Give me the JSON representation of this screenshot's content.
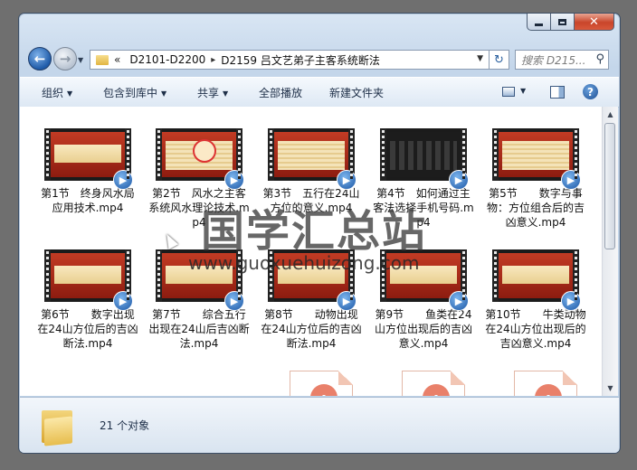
{
  "window": {
    "caption_min": "minimize",
    "caption_max": "maximize",
    "caption_close": "✕"
  },
  "address": {
    "prefix": "«",
    "crumbs": [
      "D2101-D2200",
      "D2159 吕文艺弟子主客系统断法"
    ],
    "separator": "▸"
  },
  "search": {
    "placeholder": "搜索 D215..."
  },
  "toolbar": {
    "organize": "组织",
    "include_library": "包含到库中",
    "share": "共享",
    "play_all": "全部播放",
    "new_folder": "新建文件夹",
    "help": "?"
  },
  "files": [
    {
      "label": "第1节　终身风水局应用技术.mp4",
      "style": "title"
    },
    {
      "label": "第2节　风水之主客系统风水理论技术.mp4",
      "style": "wheel"
    },
    {
      "label": "第3节　五行在24山方位的意义.mp4",
      "style": "text"
    },
    {
      "label": "第4节　如何通过主客法选择手机号码.mp4",
      "style": "dark"
    },
    {
      "label": "第5节　　数字与事物：方位组合后的吉凶意义.mp4",
      "style": "text"
    },
    {
      "label": "第6节　　数字出现在24山方位后的吉凶断法.mp4",
      "style": "band"
    },
    {
      "label": "第7节　　综合五行出现在24山后吉凶断法.mp4",
      "style": "band"
    },
    {
      "label": "第8节　　动物出现在24山方位后的吉凶断法.mp4",
      "style": "band"
    },
    {
      "label": "第9节　　鱼类在24山方位出现后的吉凶意义.mp4",
      "style": "band"
    },
    {
      "label": "第10节　　牛类动物在24山方位出现后的吉凶意义.mp4",
      "style": "band"
    }
  ],
  "status": {
    "count": "21 个对象"
  },
  "watermark": {
    "title": "国学汇总站",
    "url": "www.guoxuehuizong.com"
  },
  "colors": {
    "accent": "#1c57a5",
    "film_red": "#c23b24",
    "toolbar_text": "#1e2f48"
  }
}
